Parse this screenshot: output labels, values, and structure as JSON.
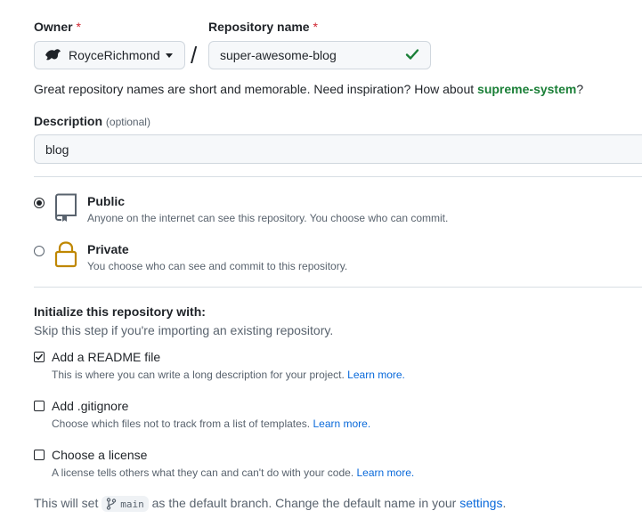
{
  "owner": {
    "label": "Owner",
    "required_mark": "*",
    "value": "RoyceRichmond"
  },
  "separator": "/",
  "repo_name": {
    "label": "Repository name",
    "required_mark": "*",
    "value": "super-awesome-blog"
  },
  "name_hint": {
    "text": "Great repository names are short and memorable. Need inspiration? How about ",
    "suggestion": "supreme-system",
    "suffix": "?"
  },
  "description": {
    "label": "Description",
    "optional": "(optional)",
    "value": "blog"
  },
  "visibility": {
    "public": {
      "title": "Public",
      "desc": "Anyone on the internet can see this repository. You choose who can commit.",
      "checked": true
    },
    "private": {
      "title": "Private",
      "desc": "You choose who can see and commit to this repository.",
      "checked": false
    }
  },
  "init": {
    "title": "Initialize this repository with:",
    "subtitle": "Skip this step if you're importing an existing repository.",
    "readme": {
      "title": "Add a README file",
      "desc": "This is where you can write a long description for your project.",
      "link": "Learn more.",
      "checked": true
    },
    "gitignore": {
      "title": "Add .gitignore",
      "desc": "Choose which files not to track from a list of templates.",
      "link": "Learn more.",
      "checked": false
    },
    "license": {
      "title": "Choose a license",
      "desc": "A license tells others what they can and can't do with your code.",
      "link": "Learn more.",
      "checked": false
    }
  },
  "footer": {
    "prefix": "This will set",
    "branch": "main",
    "middle": "as the default branch. Change the default name in your",
    "link": "settings",
    "suffix": "."
  },
  "colors": {
    "success": "#1a7f37",
    "link": "#0969da",
    "required": "#cf222e",
    "private_lock": "#bf8700"
  }
}
